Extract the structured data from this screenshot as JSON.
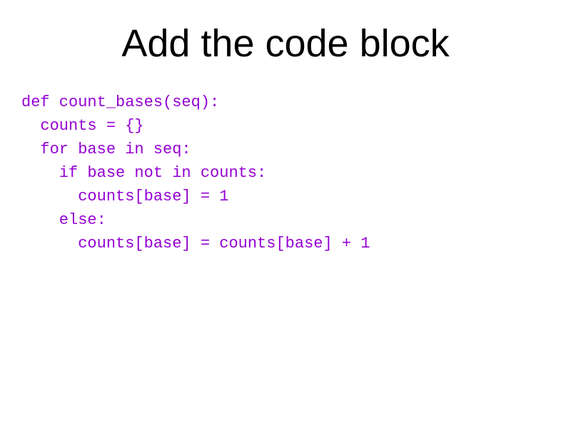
{
  "slide": {
    "title": "Add the code block",
    "code": "def count_bases(seq):\n  counts = {}\n  for base in seq:\n    if base not in counts:\n      counts[base] = 1\n    else:\n      counts[base] = counts[base] + 1"
  }
}
